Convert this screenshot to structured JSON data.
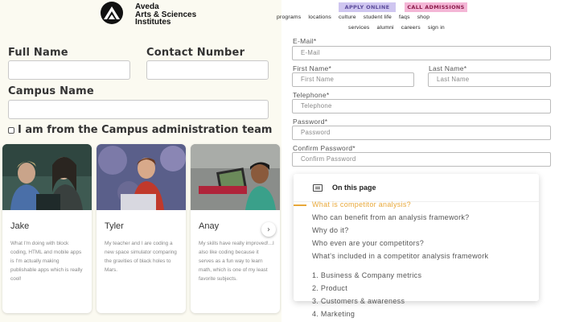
{
  "campus_form": {
    "full_name_label": "Full Name",
    "contact_number_label": "Contact Number",
    "campus_name_label": "Campus Name",
    "admin_checkbox_label": "I am from the Campus administration team"
  },
  "student_cards": [
    {
      "name": "Jake",
      "quote": "What I'm doing with block coding, HTML and mobile apps is I'm actually making publishable apps which is really cool!"
    },
    {
      "name": "Tyler",
      "quote": "My teacher and I are coding a new space simulator comparing the gravities of black holes to Mars."
    },
    {
      "name": "Anay",
      "quote": "My skills have really improved!...I also like coding because it serves as a fun way to learn math, which is one of my least favorite subjects."
    }
  ],
  "carousel": {
    "next_icon": "›"
  },
  "header": {
    "brand_line1": "Aveda",
    "brand_line2": "Arts & Sciences",
    "brand_line3": "Institutes",
    "apply_online": "APPLY ONLINE",
    "call_admissions": "CALL ADMISSIONS",
    "nav_primary": [
      "programs",
      "locations",
      "culture",
      "student life",
      "faqs",
      "shop"
    ],
    "nav_secondary": [
      "services",
      "alumni",
      "careers",
      "sign in"
    ]
  },
  "signup_form": {
    "email_label": "E-Mail*",
    "email_placeholder": "E-Mail",
    "first_name_label": "First Name*",
    "first_name_placeholder": "First Name",
    "last_name_label": "Last Name*",
    "last_name_placeholder": "Last Name",
    "telephone_label": "Telephone*",
    "telephone_placeholder": "Telephone",
    "password_label": "Password*",
    "password_placeholder": "Password",
    "confirm_password_label": "Confirm Password*",
    "confirm_password_placeholder": "Confirm Password"
  },
  "toc": {
    "title": "On this page",
    "items": [
      "What is competitor analysis?",
      "Who can benefit from an analysis framework?",
      "Why do it?",
      "Who even are your competitors?",
      "What's included in a competitor analysis framework",
      "1.  Business & Company metrics",
      "2.  Product",
      "3.  Customers & awareness",
      "4.  Marketing"
    ]
  },
  "colors": {
    "accent_orange": "#e8a83a",
    "apply_bg": "#cfc6f0",
    "call_bg": "#f4b6d6",
    "left_bg": "#fbfaf1"
  }
}
